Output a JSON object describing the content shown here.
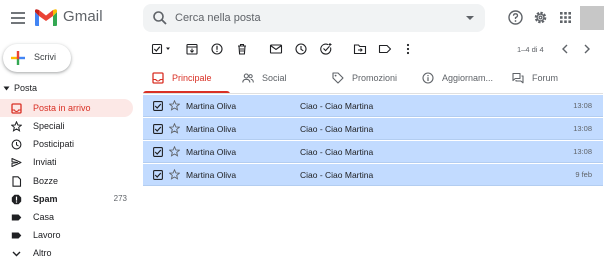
{
  "app": {
    "logo_text": "Gmail"
  },
  "search": {
    "placeholder": "Cerca nella posta",
    "value": ""
  },
  "header_icons": [
    "help-icon",
    "settings-icon",
    "apps-icon"
  ],
  "compose": {
    "label": "Scrivi"
  },
  "nav": {
    "section_title": "Posta",
    "items": [
      {
        "label": "Posta in arrivo",
        "icon": "inbox-icon",
        "active": true,
        "count": ""
      },
      {
        "label": "Speciali",
        "icon": "star-icon",
        "active": false,
        "count": ""
      },
      {
        "label": "Posticipati",
        "icon": "clock-icon",
        "active": false,
        "count": ""
      },
      {
        "label": "Inviati",
        "icon": "send-icon",
        "active": false,
        "count": ""
      },
      {
        "label": "Bozze",
        "icon": "draft-icon",
        "active": false,
        "count": ""
      },
      {
        "label": "Spam",
        "icon": "spam-icon",
        "active": false,
        "bold": true,
        "count": "273"
      },
      {
        "label": "Casa",
        "icon": "label-icon",
        "active": false,
        "count": ""
      },
      {
        "label": "Lavoro",
        "icon": "label-icon",
        "active": false,
        "count": ""
      },
      {
        "label": "Altro",
        "icon": "chevron-down-icon",
        "active": false,
        "count": ""
      }
    ]
  },
  "toolbar": {
    "icons": [
      "select-all-icon",
      "archive-icon",
      "report-spam-icon",
      "delete-icon",
      "mark-unread-icon",
      "snooze-icon",
      "add-task-icon",
      "move-to-icon",
      "label-icon",
      "more-icon"
    ],
    "pager_text": "1–4 di 4"
  },
  "tabs": [
    {
      "label": "Principale",
      "icon": "inbox-icon",
      "active": true
    },
    {
      "label": "Social",
      "icon": "people-icon",
      "active": false
    },
    {
      "label": "Promozioni",
      "icon": "tag-icon",
      "active": false
    },
    {
      "label": "Aggiornam...",
      "icon": "info-icon",
      "active": false
    },
    {
      "label": "Forum",
      "icon": "forum-icon",
      "active": false
    }
  ],
  "emails": [
    {
      "from": "Martina Oliva",
      "subject": "Ciao - Ciao Martina",
      "date": "13:08",
      "selected": true
    },
    {
      "from": "Martina Oliva",
      "subject": "Ciao - Ciao Martina",
      "date": "13:08",
      "selected": true
    },
    {
      "from": "Martina Oliva",
      "subject": "Ciao - Ciao Martina",
      "date": "13:08",
      "selected": true
    },
    {
      "from": "Martina Oliva",
      "subject": "Ciao - Ciao Martina",
      "date": "9 feb",
      "selected": true
    }
  ],
  "colors": {
    "accent_red": "#d93025",
    "selected_row": "#c2dbff",
    "active_nav_bg": "#fce8e6",
    "search_bg": "#f1f3f4"
  }
}
